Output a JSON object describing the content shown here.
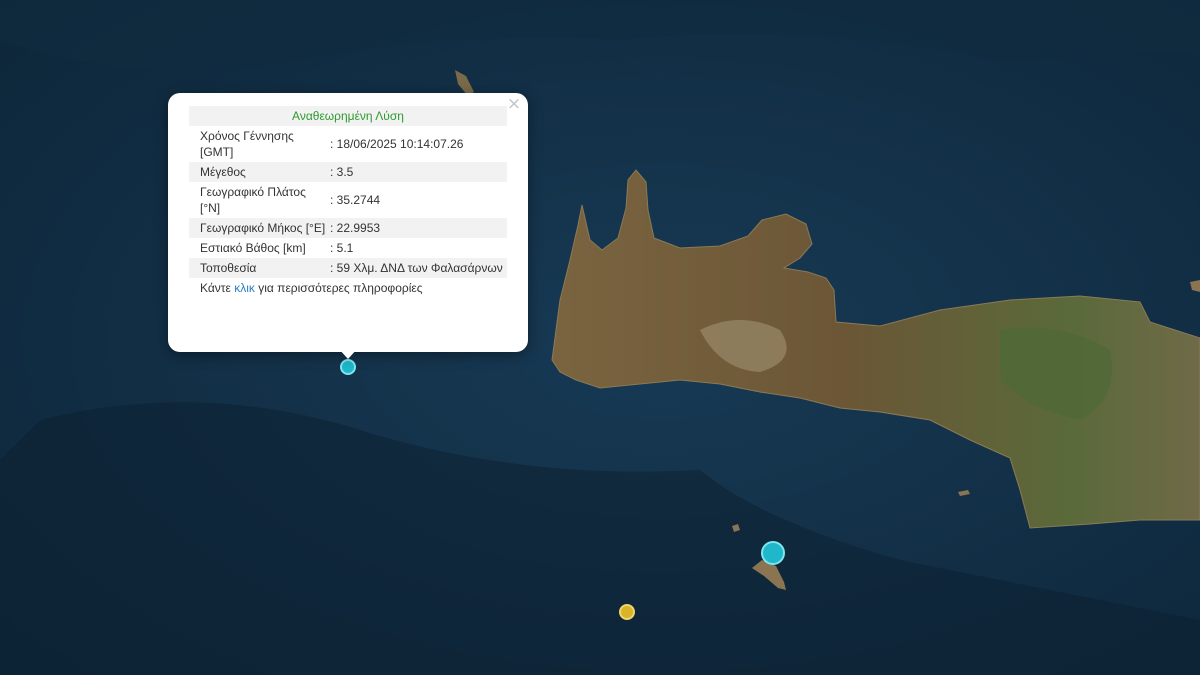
{
  "popup": {
    "title": "Αναθεωρημένη Λύση",
    "close_glyph": "×",
    "rows": [
      {
        "label": "Χρόνος Γέννησης [GMT]",
        "value": ": 18/06/2025 10:14:07.26"
      },
      {
        "label": "Μέγεθος",
        "value": ": 3.5"
      },
      {
        "label": "Γεωγραφικό Πλάτος [°N]",
        "value": ": 35.2744"
      },
      {
        "label": "Γεωγραφικό Μήκος [°E]",
        "value": ": 22.9953"
      },
      {
        "label": "Εστιακό Βάθος [km]",
        "value": ": 5.1"
      },
      {
        "label": "Τοποθεσία",
        "value": ": 59 Χλμ. ΔΝΔ των Φαλασάρνων"
      }
    ],
    "more_prefix": "Κάντε ",
    "more_link": "κλικ",
    "more_suffix": " για περισσότερες πληροφορίες"
  },
  "markers": [
    {
      "name": "selected-earthquake",
      "color": "#1fb7c9"
    },
    {
      "name": "earthquake-gavdos",
      "color": "#1fb7c9"
    },
    {
      "name": "earthquake-older",
      "color": "#d9b42a"
    }
  ],
  "colors": {
    "sea": "#0f2a3e",
    "land": "#6e5a3a",
    "title_green": "#2e9a2e",
    "link_blue": "#2a7fc2"
  }
}
